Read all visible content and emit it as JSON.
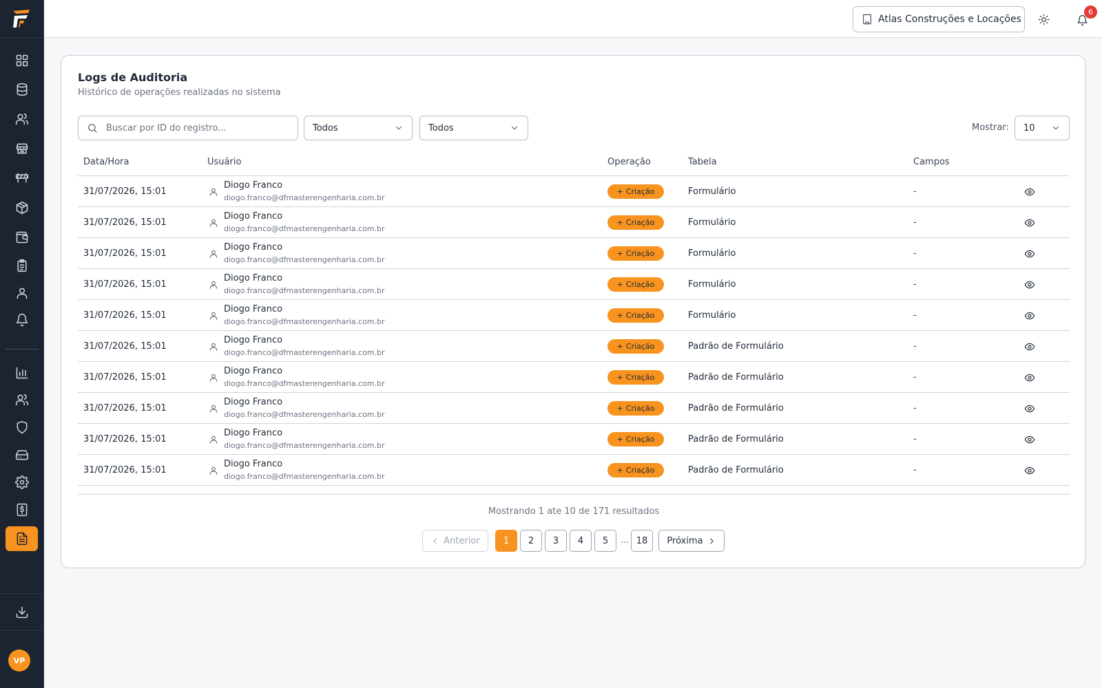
{
  "app": {
    "logo_icon": "brand-logo-icon",
    "accent_color": "#f7931e",
    "sidebar_color": "#1c2331"
  },
  "topbar": {
    "company": "Atlas Construções e Locações",
    "notifications_count": "6",
    "avatar_initials": "VP"
  },
  "sidebar": {
    "items": [
      {
        "icon": "dashboard-icon"
      },
      {
        "icon": "database-icon"
      },
      {
        "icon": "users-icon"
      },
      {
        "icon": "store-icon"
      },
      {
        "icon": "barrier-icon"
      },
      {
        "icon": "package-icon"
      },
      {
        "icon": "wallet-icon"
      },
      {
        "icon": "clipboard-icon"
      },
      {
        "icon": "user-icon"
      },
      {
        "icon": "bell-icon"
      },
      {
        "icon": "bar-chart-icon"
      },
      {
        "icon": "team-icon"
      },
      {
        "icon": "shield-icon"
      },
      {
        "icon": "hard-drive-icon"
      },
      {
        "icon": "settings-icon"
      },
      {
        "icon": "receipt-dollar-icon"
      },
      {
        "icon": "file-text-icon",
        "active": true
      }
    ],
    "download_icon": "download-icon",
    "avatar_initials": "VP"
  },
  "page": {
    "title": "Logs de Auditoria",
    "subtitle": "Histórico de operações realizadas no sistema"
  },
  "filters": {
    "search_placeholder": "Buscar por ID do registro...",
    "search_value": "",
    "operation_select": "Todos",
    "table_select": "Todos",
    "show_label": "Mostrar:",
    "page_size": "10"
  },
  "table": {
    "headers": {
      "date": "Data/Hora",
      "user": "Usuário",
      "operation": "Operação",
      "table": "Tabela",
      "fields": "Campos"
    },
    "rows": [
      {
        "date": "31/07/2026, 15:01",
        "name": "Diogo Franco",
        "email": "diogo.franco@dfmasterengenharia.com.br",
        "operation": "Criação",
        "table": "Formulário",
        "fields": "-"
      },
      {
        "date": "31/07/2026, 15:01",
        "name": "Diogo Franco",
        "email": "diogo.franco@dfmasterengenharia.com.br",
        "operation": "Criação",
        "table": "Formulário",
        "fields": "-"
      },
      {
        "date": "31/07/2026, 15:01",
        "name": "Diogo Franco",
        "email": "diogo.franco@dfmasterengenharia.com.br",
        "operation": "Criação",
        "table": "Formulário",
        "fields": "-"
      },
      {
        "date": "31/07/2026, 15:01",
        "name": "Diogo Franco",
        "email": "diogo.franco@dfmasterengenharia.com.br",
        "operation": "Criação",
        "table": "Formulário",
        "fields": "-"
      },
      {
        "date": "31/07/2026, 15:01",
        "name": "Diogo Franco",
        "email": "diogo.franco@dfmasterengenharia.com.br",
        "operation": "Criação",
        "table": "Formulário",
        "fields": "-"
      },
      {
        "date": "31/07/2026, 15:01",
        "name": "Diogo Franco",
        "email": "diogo.franco@dfmasterengenharia.com.br",
        "operation": "Criação",
        "table": "Padrão de Formulário",
        "fields": "-"
      },
      {
        "date": "31/07/2026, 15:01",
        "name": "Diogo Franco",
        "email": "diogo.franco@dfmasterengenharia.com.br",
        "operation": "Criação",
        "table": "Padrão de Formulário",
        "fields": "-"
      },
      {
        "date": "31/07/2026, 15:01",
        "name": "Diogo Franco",
        "email": "diogo.franco@dfmasterengenharia.com.br",
        "operation": "Criação",
        "table": "Padrão de Formulário",
        "fields": "-"
      },
      {
        "date": "31/07/2026, 15:01",
        "name": "Diogo Franco",
        "email": "diogo.franco@dfmasterengenharia.com.br",
        "operation": "Criação",
        "table": "Padrão de Formulário",
        "fields": "-"
      },
      {
        "date": "31/07/2026, 15:01",
        "name": "Diogo Franco",
        "email": "diogo.franco@dfmasterengenharia.com.br",
        "operation": "Criação",
        "table": "Padrão de Formulário",
        "fields": "-"
      }
    ]
  },
  "pagination": {
    "summary": "Mostrando 1 ate 10 de 171 resultados",
    "prev": "Anterior",
    "next": "Próxima",
    "pages": [
      "1",
      "2",
      "3",
      "4",
      "5"
    ],
    "ellipsis": "...",
    "last_page": "18",
    "current": "1"
  }
}
